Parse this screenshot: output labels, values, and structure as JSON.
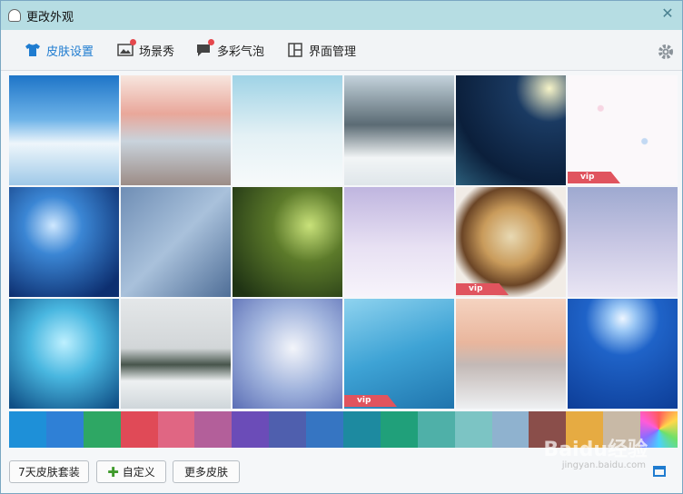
{
  "window": {
    "title": "更改外观"
  },
  "tabs": [
    {
      "label": "皮肤设置",
      "active": true
    },
    {
      "label": "场景秀",
      "badge": true
    },
    {
      "label": "多彩气泡",
      "badge": true
    },
    {
      "label": "界面管理"
    }
  ],
  "skins": [
    {
      "name": "sky-clouds",
      "vip": false
    },
    {
      "name": "snowy-street",
      "vip": false
    },
    {
      "name": "snowman",
      "vip": false
    },
    {
      "name": "snowy-trees-road",
      "vip": false
    },
    {
      "name": "night-lamp-umbrella",
      "vip": false
    },
    {
      "name": "flower-pattern",
      "vip": true
    },
    {
      "name": "snowflake-blue",
      "vip": false
    },
    {
      "name": "merry-christmas-glass",
      "vip": false
    },
    {
      "name": "pine-branch",
      "vip": false
    },
    {
      "name": "couple-snow-walk",
      "vip": false
    },
    {
      "name": "coffee-snowflake",
      "vip": true
    },
    {
      "name": "purple-winter-trees",
      "vip": false
    },
    {
      "name": "frozen-branch-blue",
      "vip": false
    },
    {
      "name": "snowy-lake-birds",
      "vip": false
    },
    {
      "name": "bird-berries",
      "vip": false
    },
    {
      "name": "white-feather",
      "vip": true
    },
    {
      "name": "sunset-snow-fence",
      "vip": false
    },
    {
      "name": "moon-reindeer-sleigh",
      "vip": false
    }
  ],
  "vip_label": "vip",
  "swatch_colors": [
    "#1e90d8",
    "#2f80d6",
    "#2ea764",
    "#e04a57",
    "#e06683",
    "#b35f9a",
    "#6b4cb8",
    "#4f5fae",
    "#3675c2",
    "#1d8aa0",
    "#20a07a",
    "#4fb0a8",
    "#7cc4c4",
    "#8fb2cf",
    "#8a4e4a",
    "#e6ab42",
    "#c8b9a6",
    "#7fdc7a"
  ],
  "footer": {
    "btn_7days": "7天皮肤套装",
    "btn_custom": "自定义",
    "btn_more": "更多皮肤"
  },
  "watermark": {
    "main": "Baidu经验",
    "sub": "jingyan.baidu.com"
  }
}
